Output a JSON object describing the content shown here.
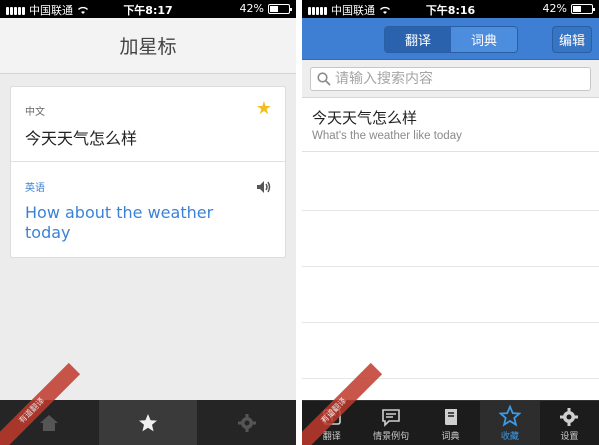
{
  "status_bar_left": {
    "carrier": "中国联通",
    "time": "下午8:17",
    "battery": "42%",
    "battery_level": 0.42
  },
  "status_bar_right": {
    "carrier": "中国联通",
    "time": "下午8:16",
    "battery": "42%",
    "battery_level": 0.42
  },
  "left_screen": {
    "title": "加星标",
    "source_label": "中文",
    "source_text": "今天天气怎么样",
    "target_label": "英语",
    "target_text": "How about the weather today",
    "starred": true,
    "footer_tabs": [
      {
        "icon": "home-icon"
      },
      {
        "icon": "star-icon"
      },
      {
        "icon": "gear-icon"
      }
    ],
    "ribbon_text": "有道翻译"
  },
  "right_screen": {
    "segments": [
      "翻译",
      "词典"
    ],
    "active_segment": "翻译",
    "edit_button": "编辑",
    "search_placeholder": "请输入搜索内容",
    "favorites": [
      {
        "source": "今天天气怎么样",
        "translation": "What's the weather like today"
      }
    ],
    "tabs": [
      {
        "label": "翻译",
        "icon": "translate-icon"
      },
      {
        "label": "情景例句",
        "icon": "chat-icon"
      },
      {
        "label": "词典",
        "icon": "book-icon"
      },
      {
        "label": "收藏",
        "icon": "star-icon"
      },
      {
        "label": "设置",
        "icon": "gear-icon"
      }
    ],
    "active_tab": "收藏",
    "ribbon_text": "有道翻译"
  },
  "colors": {
    "accent_blue": "#3e7ed3",
    "star_gold": "#f3be22",
    "link_blue": "#3b82d6"
  }
}
